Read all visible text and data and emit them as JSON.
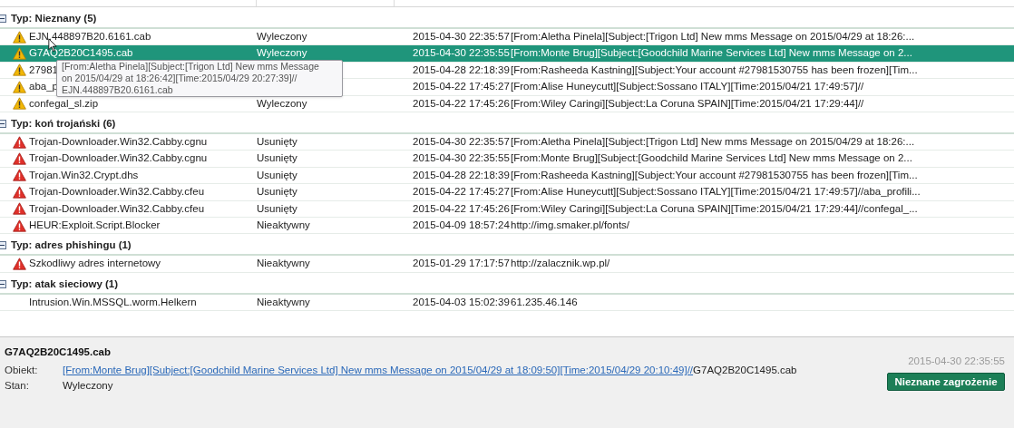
{
  "groups": [
    {
      "title": "Typ: Nieznany (5)",
      "expanded": true,
      "rows": [
        {
          "kind": "warning",
          "selected": false,
          "name": "EJN.448897B20.6161.cab",
          "status": "Wyleczony",
          "date": "2015-04-30 22:35:57",
          "details": "[From:Aletha Pinela][Subject:[Trigon Ltd] New mms Message on 2015/04/29 at 18:26:..."
        },
        {
          "kind": "warning",
          "selected": true,
          "name": "G7AQ2B20C1495.cab",
          "status": "Wyleczony",
          "date": "2015-04-30 22:35:55",
          "details": "[From:Monte Brug][Subject:[Goodchild Marine Services Ltd] New mms Message on 2..."
        },
        {
          "kind": "warning",
          "selected": false,
          "name": "27981",
          "date": "2015-04-28 22:18:39",
          "details": "[From:Rasheeda Kastning][Subject:Your account #27981530755 has been frozen][Tim..."
        },
        {
          "kind": "warning",
          "selected": false,
          "name": "aba_p",
          "date": "2015-04-22 17:45:27",
          "details": "[From:Alise Huneycutt][Subject:Sossano ITALY][Time:2015/04/21 17:49:57]//"
        },
        {
          "kind": "warning",
          "selected": false,
          "name": "confegal_sl.zip",
          "status": "Wyleczony",
          "date": "2015-04-22 17:45:26",
          "details": "[From:Wiley Caringi][Subject:La Coruna SPAIN][Time:2015/04/21 17:29:44]//"
        }
      ]
    },
    {
      "title": "Typ: koń trojański (6)",
      "expanded": true,
      "rows": [
        {
          "kind": "danger",
          "selected": false,
          "name": "Trojan-Downloader.Win32.Cabby.cgnu",
          "status": "Usunięty",
          "date": "2015-04-30 22:35:57",
          "details": "[From:Aletha Pinela][Subject:[Trigon Ltd] New mms Message on 2015/04/29 at 18:26:..."
        },
        {
          "kind": "danger",
          "selected": false,
          "name": "Trojan-Downloader.Win32.Cabby.cgnu",
          "status": "Usunięty",
          "date": "2015-04-30 22:35:55",
          "details": "[From:Monte Brug][Subject:[Goodchild Marine Services Ltd] New mms Message on 2..."
        },
        {
          "kind": "danger",
          "selected": false,
          "name": "Trojan.Win32.Crypt.dhs",
          "status": "Usunięty",
          "date": "2015-04-28 22:18:39",
          "details": "[From:Rasheeda Kastning][Subject:Your account #27981530755 has been frozen][Tim..."
        },
        {
          "kind": "danger",
          "selected": false,
          "name": "Trojan-Downloader.Win32.Cabby.cfeu",
          "status": "Usunięty",
          "date": "2015-04-22 17:45:27",
          "details": "[From:Alise Huneycutt][Subject:Sossano ITALY][Time:2015/04/21 17:49:57]//aba_profili..."
        },
        {
          "kind": "danger",
          "selected": false,
          "name": "Trojan-Downloader.Win32.Cabby.cfeu",
          "status": "Usunięty",
          "date": "2015-04-22 17:45:26",
          "details": "[From:Wiley Caringi][Subject:La Coruna SPAIN][Time:2015/04/21 17:29:44]//confegal_..."
        },
        {
          "kind": "danger",
          "selected": false,
          "name": "HEUR:Exploit.Script.Blocker",
          "status": "Nieaktywny",
          "date": "2015-04-09 18:57:24",
          "details": "http://img.smaker.pl/fonts/"
        }
      ]
    },
    {
      "title": "Typ: adres phishingu (1)",
      "expanded": true,
      "rows": [
        {
          "kind": "danger",
          "selected": false,
          "name": "Szkodliwy adres internetowy",
          "status": "Nieaktywny",
          "date": "2015-01-29 17:17:57",
          "details": "http://zalacznik.wp.pl/"
        }
      ]
    },
    {
      "title": "Typ: atak sieciowy (1)",
      "expanded": true,
      "rows": [
        {
          "kind": "plain",
          "selected": false,
          "name": "Intrusion.Win.MSSQL.worm.Helkern",
          "status": "Nieaktywny",
          "date": "2015-04-03 15:02:39",
          "details": "61.235.46.146"
        }
      ]
    }
  ],
  "tooltip": {
    "lines": [
      "[From:Aletha Pinela][Subject:[Trigon Ltd] New mms Message",
      "on 2015/04/29 at 18:26:42][Time:2015/04/29 20:27:39]//",
      "EJN.448897B20.6161.cab"
    ]
  },
  "detail": {
    "title": "G7AQ2B20C1495.cab",
    "date": "2015-04-30 22:35:55",
    "fields": [
      {
        "label": "Obiekt:",
        "link": "[From:Monte Brug][Subject:[Goodchild Marine Services Ltd] New mms Message on 2015/04/29 at 18:09:50][Time:2015/04/29 20:10:49]//",
        "value": "G7AQ2B20C1495.cab"
      },
      {
        "label": "Stan:",
        "value": "Wyleczony"
      }
    ],
    "button": "Nieznane zagrożenie"
  }
}
